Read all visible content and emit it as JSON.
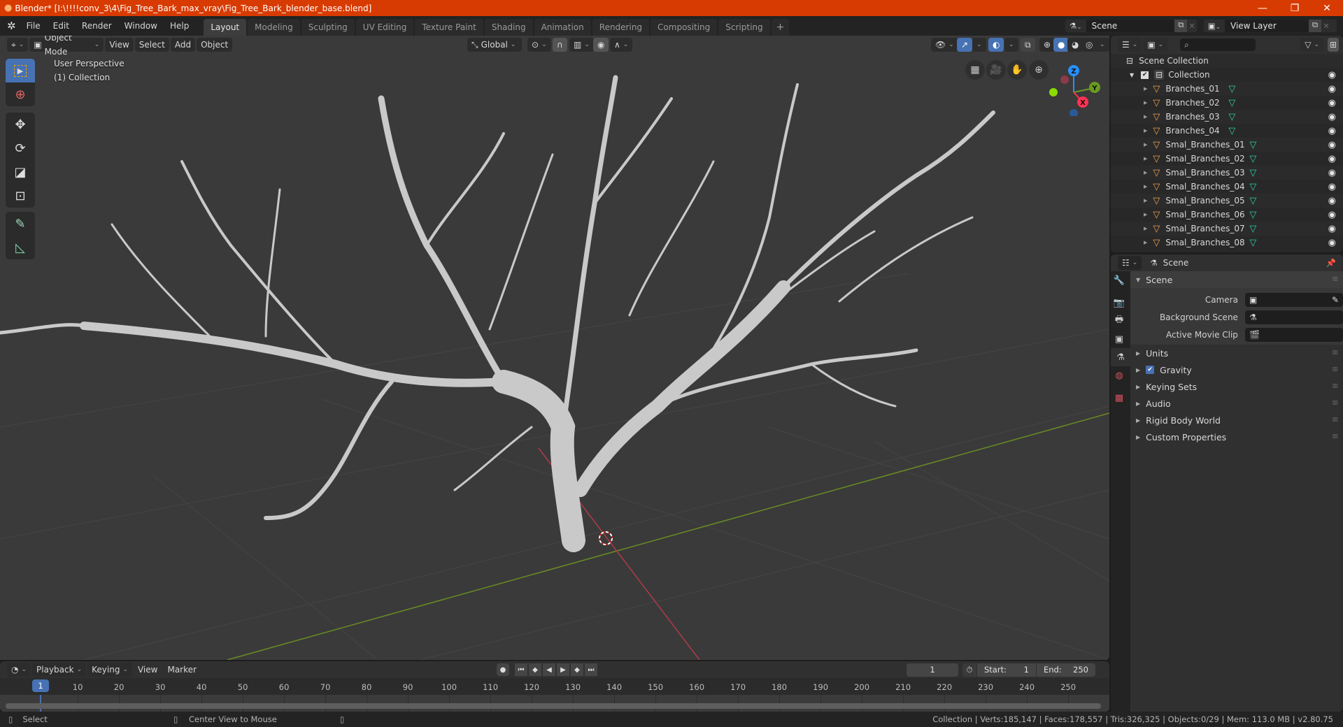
{
  "window": {
    "title": "Blender* [I:\\!!!!conv_3\\4\\Fig_Tree_Bark_max_vray\\Fig_Tree_Bark_blender_base.blend]",
    "controls": {
      "minimize": "—",
      "restore": "❐",
      "close": "✕"
    }
  },
  "topbar": {
    "menus": [
      "File",
      "Edit",
      "Render",
      "Window",
      "Help"
    ],
    "workspaces": [
      "Layout",
      "Modeling",
      "Sculpting",
      "UV Editing",
      "Texture Paint",
      "Shading",
      "Animation",
      "Rendering",
      "Compositing",
      "Scripting"
    ],
    "active_workspace": "Layout",
    "add_workspace": "+",
    "scene_field": "Scene",
    "view_layer_field": "View Layer"
  },
  "viewport": {
    "mode": "Object Mode",
    "menus": [
      "View",
      "Select",
      "Add",
      "Object"
    ],
    "transform_orientation": "Global",
    "overlay_text": {
      "line1": "User Perspective",
      "line2": "(1) Collection"
    },
    "gizmo_axes": {
      "z": "Z",
      "y": "Y",
      "x": "X"
    },
    "colors": {
      "x_axis": "#ff3352",
      "y_axis": "#8bdc00",
      "z_axis": "#2890ff",
      "active_blue": "#4772b3"
    }
  },
  "outliner": {
    "root": "Scene Collection",
    "collection": "Collection",
    "objects": [
      "Branches_01",
      "Branches_02",
      "Branches_03",
      "Branches_04",
      "Smal_Branches_01",
      "Smal_Branches_02",
      "Smal_Branches_03",
      "Smal_Branches_04",
      "Smal_Branches_05",
      "Smal_Branches_06",
      "Smal_Branches_07",
      "Smal_Branches_08"
    ]
  },
  "properties": {
    "context": "Scene",
    "panel_title": "Scene",
    "fields": [
      {
        "label": "Camera",
        "value": ""
      },
      {
        "label": "Background Scene",
        "value": ""
      },
      {
        "label": "Active Movie Clip",
        "value": ""
      }
    ],
    "collapsed_panels": [
      {
        "label": "Units",
        "checkbox": false
      },
      {
        "label": "Gravity",
        "checkbox": true,
        "checked": true
      },
      {
        "label": "Keying Sets",
        "checkbox": false
      },
      {
        "label": "Audio",
        "checkbox": false
      },
      {
        "label": "Rigid Body World",
        "checkbox": false
      },
      {
        "label": "Custom Properties",
        "checkbox": false
      }
    ]
  },
  "timeline": {
    "menus": [
      "Playback",
      "Keying",
      "View",
      "Marker"
    ],
    "current_frame": "1",
    "start_label": "Start:",
    "start": "1",
    "end_label": "End:",
    "end": "250",
    "ticks": [
      "10",
      "20",
      "30",
      "40",
      "50",
      "60",
      "70",
      "80",
      "90",
      "100",
      "110",
      "120",
      "130",
      "140",
      "150",
      "160",
      "170",
      "180",
      "190",
      "200",
      "210",
      "220",
      "230",
      "240",
      "250"
    ]
  },
  "statusbar": {
    "hint_left": "Select",
    "hint_middle": "Center View to Mouse",
    "stats": "Collection | Verts:185,147 | Faces:178,557 | Tris:326,325 | Objects:0/29 | Mem: 113.0 MB | v2.80.75"
  }
}
